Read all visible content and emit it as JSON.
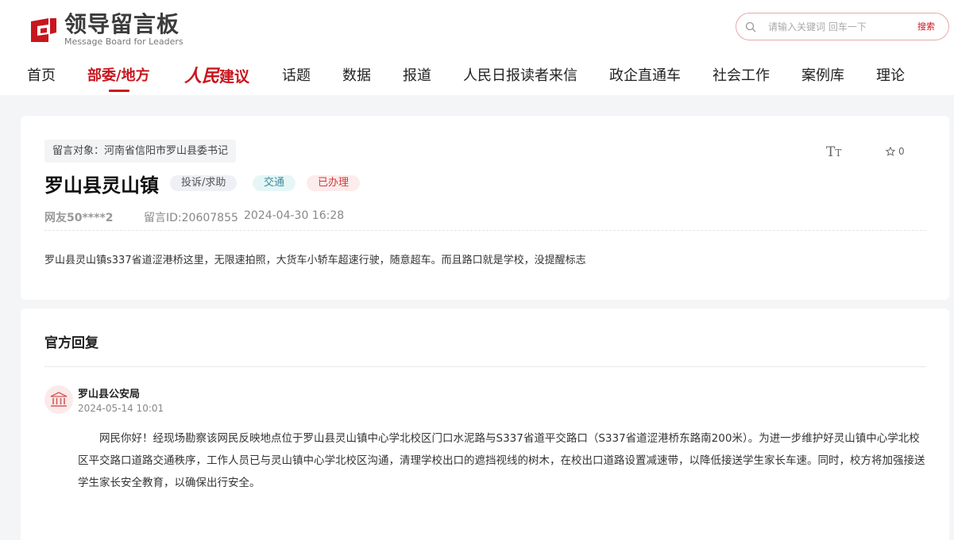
{
  "header": {
    "logo": {
      "title_cn": "领导留言板",
      "title_en": "Message Board for Leaders"
    },
    "search": {
      "placeholder": "请输入关键词 回车一下",
      "button_label": "搜索"
    },
    "nav": [
      {
        "label": "首页"
      },
      {
        "label": "部委/地方",
        "active": true
      },
      {
        "brand_script": "人民",
        "brand_text": "建议"
      },
      {
        "label": "话题"
      },
      {
        "label": "数据"
      },
      {
        "label": "报道"
      },
      {
        "label": "人民日报读者来信"
      },
      {
        "label": "政企直通车"
      },
      {
        "label": "社会工作"
      },
      {
        "label": "案例库"
      },
      {
        "label": "理论"
      }
    ]
  },
  "message": {
    "target": "留言对象：河南省信阳市罗山县委书记",
    "title": "罗山县灵山镇",
    "tags": {
      "type": "投诉/求助",
      "domain": "交通",
      "status": "已办理"
    },
    "favorite_count": "0",
    "user": "网友50****2",
    "message_id": "留言ID:20607855",
    "time": "2024-04-30 16:28",
    "content": "罗山县灵山镇s337省道涩港桥这里，无限速拍照，大货车小轿车超速行驶，随意超车。而且路口就是学校，没提醒标志"
  },
  "reply": {
    "section_title": "官方回复",
    "department": "罗山县公安局",
    "time": "2024-05-14 10:01",
    "body": "网民你好！经现场勘察该网民反映地点位于罗山县灵山镇中心学北校区门口水泥路与S337省道平交路口（S337省道涩港桥东路南200米）。为进一步维护好灵山镇中心学北校区平交路口道路交通秩序，工作人员已与灵山镇中心学北校区沟通，清理学校出口的遮挡视线的树木，在校出口道路设置减速带，以降低接送学生家长车速。同时，校方将加强接送学生家长安全教育，以确保出行安全。"
  },
  "colors": {
    "brand_red": "#c8161e",
    "page_bg": "#f4f5f7"
  }
}
